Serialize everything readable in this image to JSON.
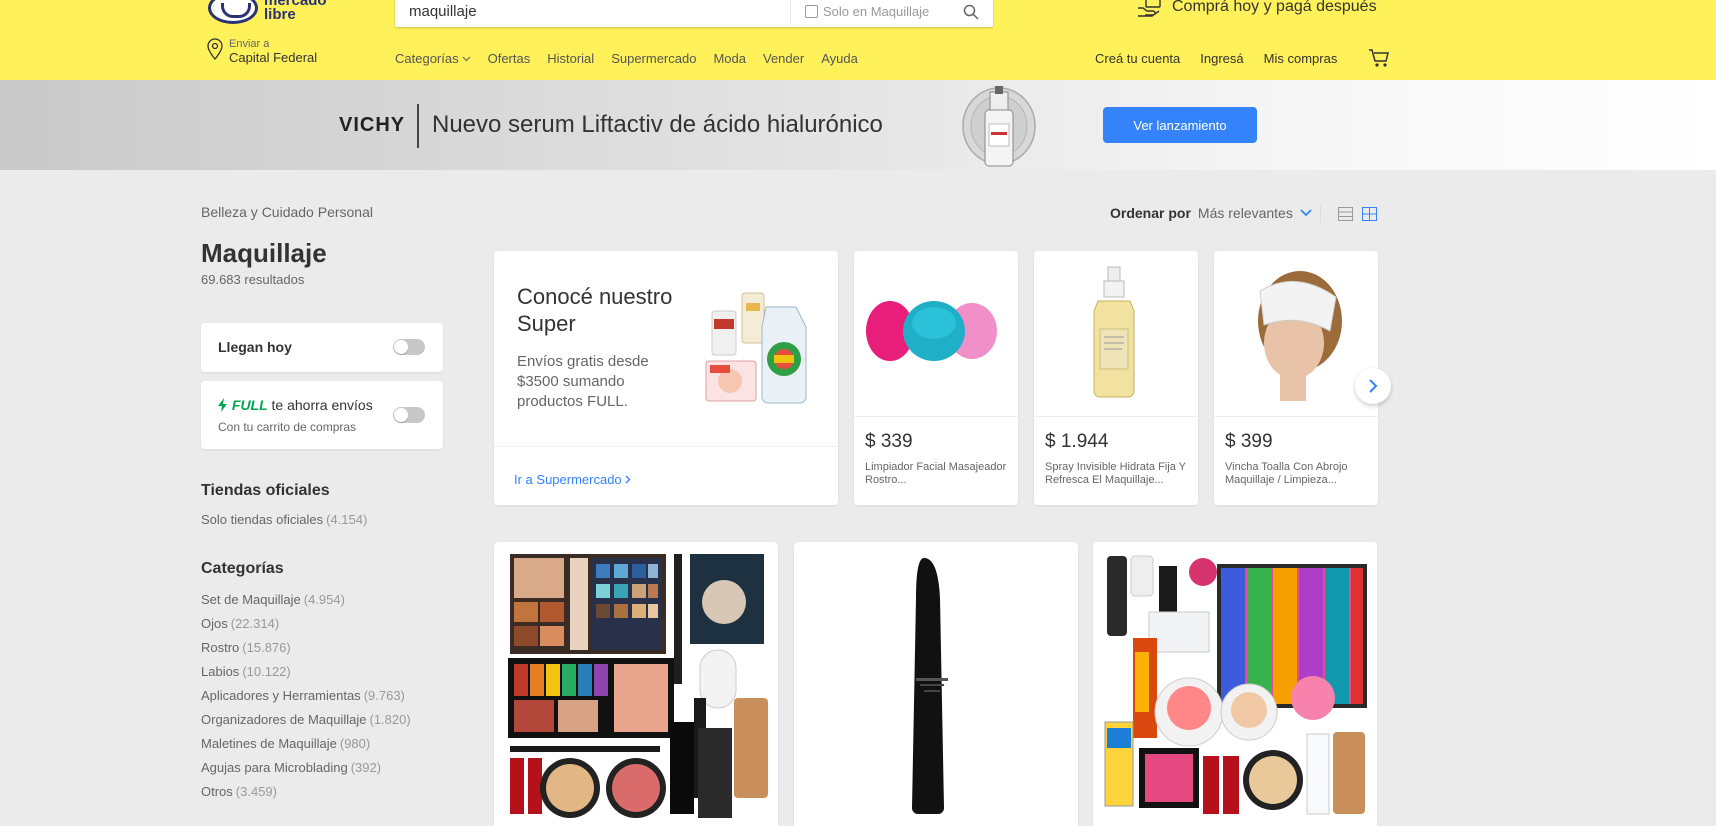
{
  "header": {
    "logo_text": "mercado libre",
    "search": {
      "value": "maquillaje",
      "only_in_label": "Solo en Maquillaje"
    },
    "promo": "Comprá hoy y pagá después",
    "location": {
      "label": "Enviar a",
      "value": "Capital Federal"
    },
    "nav": [
      "Categorías",
      "Ofertas",
      "Historial",
      "Supermercado",
      "Moda",
      "Vender",
      "Ayuda"
    ],
    "user_nav": [
      "Creá tu cuenta",
      "Ingresá",
      "Mis compras"
    ]
  },
  "banner": {
    "brand": "VICHY",
    "text": "Nuevo serum Liftactiv de ácido hialurónico",
    "button": "Ver lanzamiento"
  },
  "sidebar": {
    "breadcrumb": "Belleza y Cuidado Personal",
    "title": "Maquillaje",
    "results": "69.683 resultados",
    "llegan_hoy": "Llegan hoy",
    "full": {
      "badge": "FULL",
      "text": "te ahorra envíos",
      "sub": "Con tu carrito de compras"
    },
    "official_heading": "Tiendas oficiales",
    "official": {
      "label": "Solo tiendas oficiales",
      "count": "(4.154)"
    },
    "categories_heading": "Categorías",
    "categories": [
      {
        "label": "Set de Maquillaje",
        "count": "(4.954)"
      },
      {
        "label": "Ojos",
        "count": "(22.314)"
      },
      {
        "label": "Rostro",
        "count": "(15.876)"
      },
      {
        "label": "Labios",
        "count": "(10.122)"
      },
      {
        "label": "Aplicadores y Herramientas",
        "count": "(9.763)"
      },
      {
        "label": "Organizadores de Maquillaje",
        "count": "(1.820)"
      },
      {
        "label": "Maletines de Maquillaje",
        "count": "(980)"
      },
      {
        "label": "Agujas para Microblading",
        "count": "(392)"
      },
      {
        "label": "Otros",
        "count": "(3.459)"
      }
    ]
  },
  "toolbar": {
    "sort_label": "Ordenar por",
    "sort_value": "Más relevantes"
  },
  "super_card": {
    "title": "Conocé nuestro Super",
    "desc": "Envíos gratis desde $3500 sumando productos FULL.",
    "link": "Ir a Supermercado"
  },
  "products": [
    {
      "price": "$ 339",
      "title": "Limpiador Facial Masajeador Rostro..."
    },
    {
      "price": "$ 1.944",
      "title": "Spray Invisible Hidrata Fija Y Refresca El Maquillaje..."
    },
    {
      "price": "$ 399",
      "title": "Vincha Toalla Con Abrojo Maquillaje / Limpieza..."
    }
  ],
  "colors": {
    "header": "#fff159",
    "accent": "#3483fa",
    "full_green": "#00a650",
    "background": "#ebebeb"
  },
  "icons": [
    "location-pin-icon",
    "search-icon",
    "hand-card-icon",
    "cart-icon",
    "chevron-down-icon",
    "chevron-right-icon",
    "list-view-icon",
    "grid-view-icon",
    "lightning-icon"
  ]
}
